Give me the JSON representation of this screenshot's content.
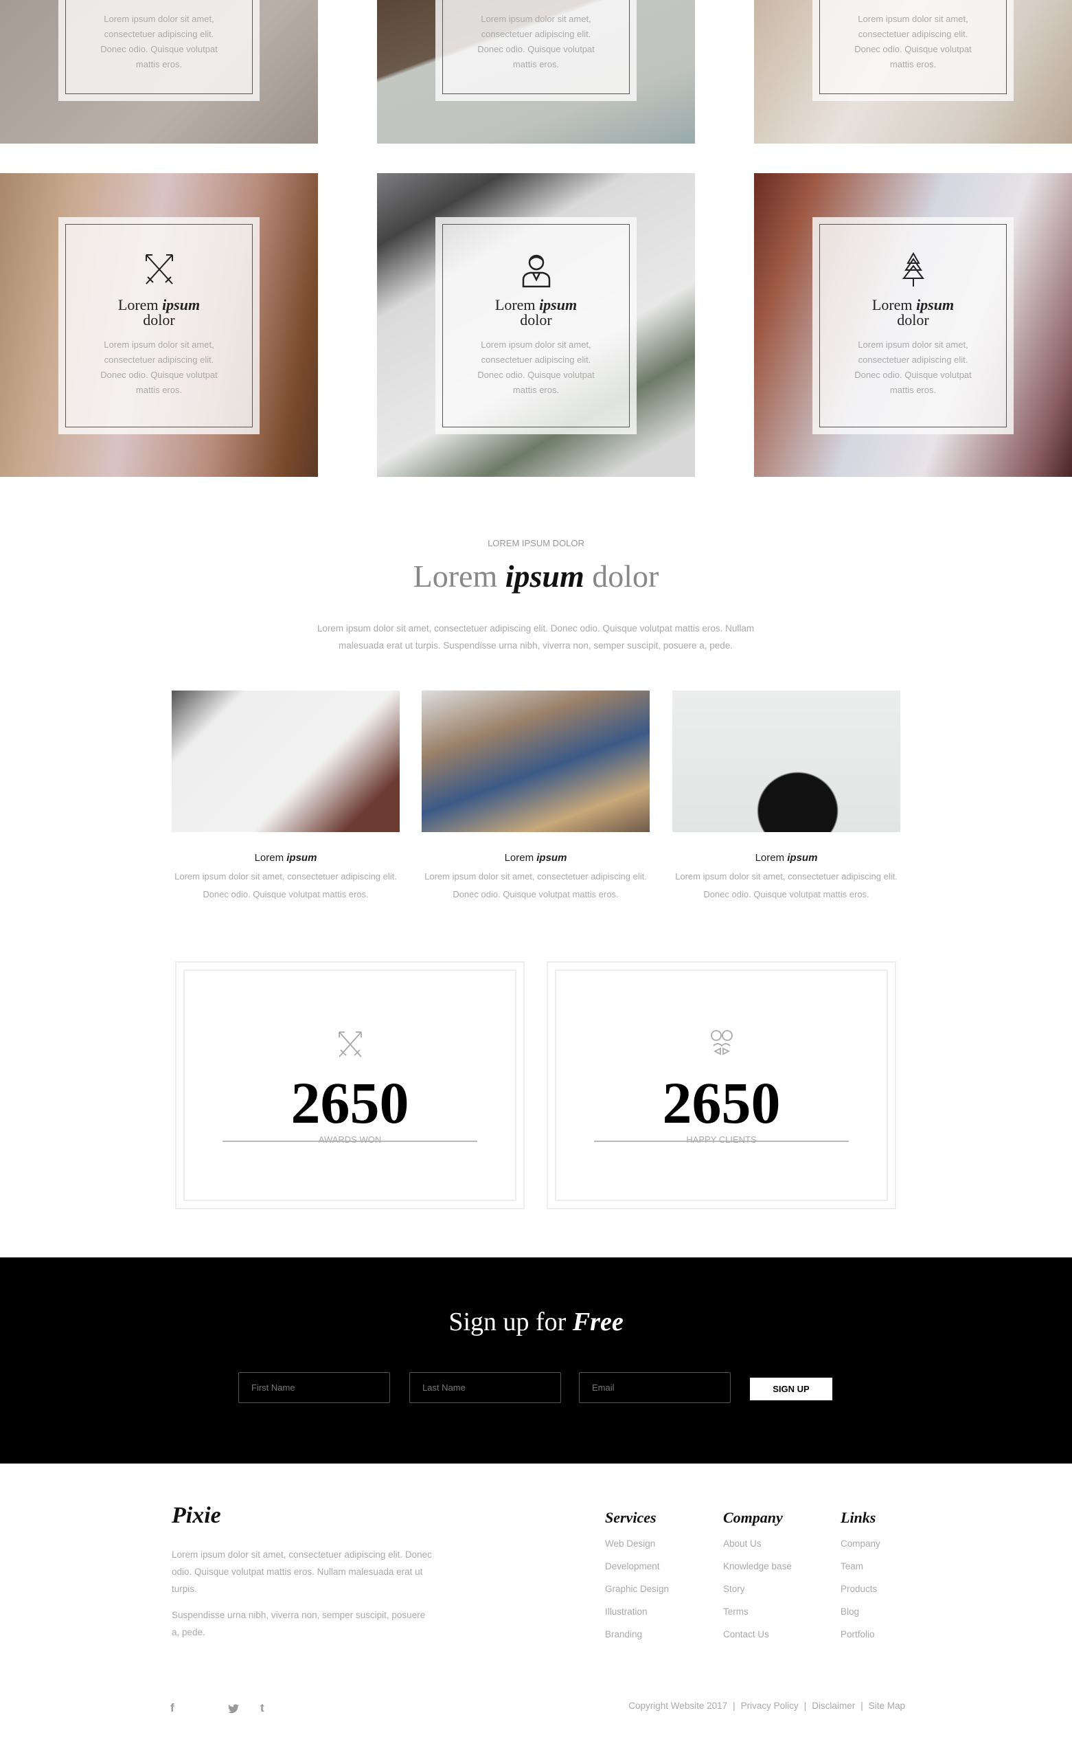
{
  "top_cards": [
    {
      "desc": "Lorem ipsum dolor sit amet, consectetuer adipiscing elit. Donec odio. Quisque volutpat mattis eros."
    },
    {
      "desc": "Lorem ipsum dolor sit amet, consectetuer adipiscing elit. Donec odio. Quisque volutpat mattis eros."
    },
    {
      "desc": "Lorem ipsum dolor sit amet, consectetuer adipiscing elit. Donec odio. Quisque volutpat mattis eros."
    }
  ],
  "feature_cards": [
    {
      "icon": "crossed-arrows-icon",
      "title_a": "Lorem ",
      "title_b": "ipsum",
      "title_c": "dolor",
      "desc": "Lorem ipsum dolor sit amet, consectetuer adipiscing elit. Donec odio. Quisque volutpat mattis eros."
    },
    {
      "icon": "person-icon",
      "title_a": "Lorem ",
      "title_b": "ipsum",
      "title_c": "dolor",
      "desc": "Lorem ipsum dolor sit amet, consectetuer adipiscing elit. Donec odio. Quisque volutpat mattis eros."
    },
    {
      "icon": "pine-tree-icon",
      "title_a": "Lorem ",
      "title_b": "ipsum",
      "title_c": "dolor",
      "desc": "Lorem ipsum dolor sit amet, consectetuer adipiscing elit. Donec odio. Quisque volutpat mattis eros."
    }
  ],
  "section": {
    "label": "LOREM IPSUM DOLOR",
    "title_a": "Lorem ",
    "title_b": "ipsum",
    "title_c": " dolor",
    "paragraph": "Lorem ipsum dolor sit amet, consectetuer adipiscing elit. Donec odio. Quisque volutpat mattis eros. Nullam malesuada erat ut turpis. Suspendisse urna nibh, viverra non, semper suscipit, posuere a, pede."
  },
  "portfolio": [
    {
      "title_a": "Lorem ",
      "title_b": "ipsum",
      "desc": "Lorem ipsum dolor sit amet, consectetuer adipiscing elit. Donec odio. Quisque volutpat mattis eros."
    },
    {
      "title_a": "Lorem ",
      "title_b": "ipsum",
      "desc": "Lorem ipsum dolor sit amet, consectetuer adipiscing elit. Donec odio. Quisque volutpat mattis eros."
    },
    {
      "title_a": "Lorem ",
      "title_b": "ipsum",
      "desc": "Lorem ipsum dolor sit amet, consectetuer adipiscing elit. Donec odio. Quisque volutpat mattis eros."
    }
  ],
  "stats": [
    {
      "icon": "crossed-arrows-icon",
      "number": "2650",
      "label": "AWARDS WON"
    },
    {
      "icon": "hipster-face-icon",
      "number": "2650",
      "label": "HAPPY CLIENTS"
    }
  ],
  "signup": {
    "title_a": "Sign up for ",
    "title_b": "Free",
    "first_name_placeholder": "First Name",
    "last_name_placeholder": "Last Name",
    "email_placeholder": "Email",
    "button": "SIGN UP"
  },
  "footer": {
    "logo": "Pixie",
    "p1": "Lorem ipsum dolor sit amet, consectetuer adipiscing elit. Donec odio. Quisque volutpat mattis eros. Nullam malesuada erat ut turpis.",
    "p2": "Suspendisse urna nibh, viverra non, semper suscipit, posuere a, pede.",
    "columns": [
      {
        "title": "Services",
        "items": [
          "Web Design",
          "Development",
          "Graphic Design",
          "Illustration",
          "Branding"
        ]
      },
      {
        "title": "Company",
        "items": [
          "About Us",
          "Knowledge base",
          "Story",
          "Terms",
          "Contact Us"
        ]
      },
      {
        "title": "Links",
        "items": [
          "Company",
          "Team",
          "Products",
          "Blog",
          "Portfolio"
        ]
      }
    ],
    "social": {
      "facebook": "f",
      "twitter": "t-bird",
      "tumblr": "t"
    },
    "copyright": "Copyright Website 2017",
    "privacy": "Privacy Policy",
    "disclaimer": "Disclaimer",
    "sitemap": "Site Map",
    "separator": "|"
  }
}
